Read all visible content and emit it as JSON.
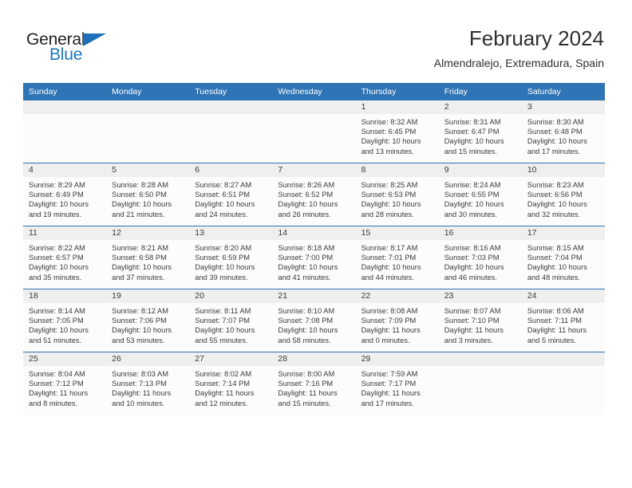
{
  "brand": {
    "name_part1": "General",
    "name_part2": "Blue",
    "triangle_icon": "triangle-icon",
    "color_dark": "#231f20",
    "color_blue": "#1e76bd"
  },
  "header": {
    "title": "February 2024",
    "subtitle": "Almendralejo, Extremadura, Spain"
  },
  "theme": {
    "header_blue": "#2f74b5",
    "day_band_gray": "#efefef",
    "cell_background": "#fcfcfc",
    "text": "#3b3b3b"
  },
  "calendar": {
    "weekday_headers": [
      "Sunday",
      "Monday",
      "Tuesday",
      "Wednesday",
      "Thursday",
      "Friday",
      "Saturday"
    ],
    "labels": {
      "sunrise": "Sunrise:",
      "sunset": "Sunset:",
      "daylight": "Daylight:"
    },
    "weeks": [
      [
        {
          "day": "",
          "sunrise": "",
          "sunset": "",
          "daylight": "",
          "empty": true
        },
        {
          "day": "",
          "sunrise": "",
          "sunset": "",
          "daylight": "",
          "empty": true
        },
        {
          "day": "",
          "sunrise": "",
          "sunset": "",
          "daylight": "",
          "empty": true
        },
        {
          "day": "",
          "sunrise": "",
          "sunset": "",
          "daylight": "",
          "empty": true
        },
        {
          "day": "1",
          "sunrise": "Sunrise: 8:32 AM",
          "sunset": "Sunset: 6:45 PM",
          "daylight": "Daylight: 10 hours and 13 minutes.",
          "empty": false
        },
        {
          "day": "2",
          "sunrise": "Sunrise: 8:31 AM",
          "sunset": "Sunset: 6:47 PM",
          "daylight": "Daylight: 10 hours and 15 minutes.",
          "empty": false
        },
        {
          "day": "3",
          "sunrise": "Sunrise: 8:30 AM",
          "sunset": "Sunset: 6:48 PM",
          "daylight": "Daylight: 10 hours and 17 minutes.",
          "empty": false
        }
      ],
      [
        {
          "day": "4",
          "sunrise": "Sunrise: 8:29 AM",
          "sunset": "Sunset: 6:49 PM",
          "daylight": "Daylight: 10 hours and 19 minutes.",
          "empty": false
        },
        {
          "day": "5",
          "sunrise": "Sunrise: 8:28 AM",
          "sunset": "Sunset: 6:50 PM",
          "daylight": "Daylight: 10 hours and 21 minutes.",
          "empty": false
        },
        {
          "day": "6",
          "sunrise": "Sunrise: 8:27 AM",
          "sunset": "Sunset: 6:51 PM",
          "daylight": "Daylight: 10 hours and 24 minutes.",
          "empty": false
        },
        {
          "day": "7",
          "sunrise": "Sunrise: 8:26 AM",
          "sunset": "Sunset: 6:52 PM",
          "daylight": "Daylight: 10 hours and 26 minutes.",
          "empty": false
        },
        {
          "day": "8",
          "sunrise": "Sunrise: 8:25 AM",
          "sunset": "Sunset: 6:53 PM",
          "daylight": "Daylight: 10 hours and 28 minutes.",
          "empty": false
        },
        {
          "day": "9",
          "sunrise": "Sunrise: 8:24 AM",
          "sunset": "Sunset: 6:55 PM",
          "daylight": "Daylight: 10 hours and 30 minutes.",
          "empty": false
        },
        {
          "day": "10",
          "sunrise": "Sunrise: 8:23 AM",
          "sunset": "Sunset: 6:56 PM",
          "daylight": "Daylight: 10 hours and 32 minutes.",
          "empty": false
        }
      ],
      [
        {
          "day": "11",
          "sunrise": "Sunrise: 8:22 AM",
          "sunset": "Sunset: 6:57 PM",
          "daylight": "Daylight: 10 hours and 35 minutes.",
          "empty": false
        },
        {
          "day": "12",
          "sunrise": "Sunrise: 8:21 AM",
          "sunset": "Sunset: 6:58 PM",
          "daylight": "Daylight: 10 hours and 37 minutes.",
          "empty": false
        },
        {
          "day": "13",
          "sunrise": "Sunrise: 8:20 AM",
          "sunset": "Sunset: 6:59 PM",
          "daylight": "Daylight: 10 hours and 39 minutes.",
          "empty": false
        },
        {
          "day": "14",
          "sunrise": "Sunrise: 8:18 AM",
          "sunset": "Sunset: 7:00 PM",
          "daylight": "Daylight: 10 hours and 41 minutes.",
          "empty": false
        },
        {
          "day": "15",
          "sunrise": "Sunrise: 8:17 AM",
          "sunset": "Sunset: 7:01 PM",
          "daylight": "Daylight: 10 hours and 44 minutes.",
          "empty": false
        },
        {
          "day": "16",
          "sunrise": "Sunrise: 8:16 AM",
          "sunset": "Sunset: 7:03 PM",
          "daylight": "Daylight: 10 hours and 46 minutes.",
          "empty": false
        },
        {
          "day": "17",
          "sunrise": "Sunrise: 8:15 AM",
          "sunset": "Sunset: 7:04 PM",
          "daylight": "Daylight: 10 hours and 48 minutes.",
          "empty": false
        }
      ],
      [
        {
          "day": "18",
          "sunrise": "Sunrise: 8:14 AM",
          "sunset": "Sunset: 7:05 PM",
          "daylight": "Daylight: 10 hours and 51 minutes.",
          "empty": false
        },
        {
          "day": "19",
          "sunrise": "Sunrise: 8:12 AM",
          "sunset": "Sunset: 7:06 PM",
          "daylight": "Daylight: 10 hours and 53 minutes.",
          "empty": false
        },
        {
          "day": "20",
          "sunrise": "Sunrise: 8:11 AM",
          "sunset": "Sunset: 7:07 PM",
          "daylight": "Daylight: 10 hours and 55 minutes.",
          "empty": false
        },
        {
          "day": "21",
          "sunrise": "Sunrise: 8:10 AM",
          "sunset": "Sunset: 7:08 PM",
          "daylight": "Daylight: 10 hours and 58 minutes.",
          "empty": false
        },
        {
          "day": "22",
          "sunrise": "Sunrise: 8:08 AM",
          "sunset": "Sunset: 7:09 PM",
          "daylight": "Daylight: 11 hours and 0 minutes.",
          "empty": false
        },
        {
          "day": "23",
          "sunrise": "Sunrise: 8:07 AM",
          "sunset": "Sunset: 7:10 PM",
          "daylight": "Daylight: 11 hours and 3 minutes.",
          "empty": false
        },
        {
          "day": "24",
          "sunrise": "Sunrise: 8:06 AM",
          "sunset": "Sunset: 7:11 PM",
          "daylight": "Daylight: 11 hours and 5 minutes.",
          "empty": false
        }
      ],
      [
        {
          "day": "25",
          "sunrise": "Sunrise: 8:04 AM",
          "sunset": "Sunset: 7:12 PM",
          "daylight": "Daylight: 11 hours and 8 minutes.",
          "empty": false
        },
        {
          "day": "26",
          "sunrise": "Sunrise: 8:03 AM",
          "sunset": "Sunset: 7:13 PM",
          "daylight": "Daylight: 11 hours and 10 minutes.",
          "empty": false
        },
        {
          "day": "27",
          "sunrise": "Sunrise: 8:02 AM",
          "sunset": "Sunset: 7:14 PM",
          "daylight": "Daylight: 11 hours and 12 minutes.",
          "empty": false
        },
        {
          "day": "28",
          "sunrise": "Sunrise: 8:00 AM",
          "sunset": "Sunset: 7:16 PM",
          "daylight": "Daylight: 11 hours and 15 minutes.",
          "empty": false
        },
        {
          "day": "29",
          "sunrise": "Sunrise: 7:59 AM",
          "sunset": "Sunset: 7:17 PM",
          "daylight": "Daylight: 11 hours and 17 minutes.",
          "empty": false
        },
        {
          "day": "",
          "sunrise": "",
          "sunset": "",
          "daylight": "",
          "empty": true
        },
        {
          "day": "",
          "sunrise": "",
          "sunset": "",
          "daylight": "",
          "empty": true
        }
      ]
    ]
  }
}
